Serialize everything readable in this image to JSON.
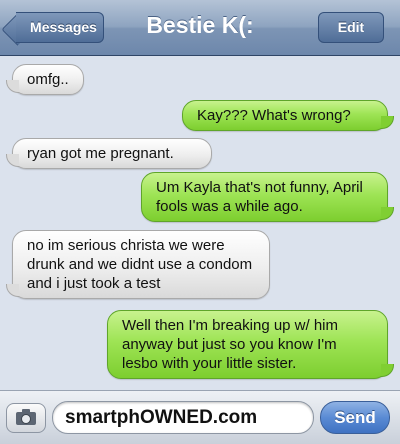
{
  "header": {
    "title": "Bestie K(:",
    "back_label": "Messages",
    "edit_label": "Edit"
  },
  "messages": [
    {
      "direction": "received",
      "text": "omfg.."
    },
    {
      "direction": "sent",
      "text": "Kay??? What's wrong?"
    },
    {
      "direction": "received",
      "text": "ryan got me pregnant."
    },
    {
      "direction": "sent",
      "text": "Um Kayla that's not funny, April fools was a while ago."
    },
    {
      "direction": "received",
      "text": "no im serious christa we were drunk and we didnt use a condom and i just took a test"
    },
    {
      "direction": "sent",
      "text": "Well then I'm breaking up w/ him anyway but just so you know I'm lesbo with your little sister."
    }
  ],
  "composer": {
    "camera_icon": "camera-icon",
    "input_value": "smartphOWNED.com",
    "send_label": "Send"
  },
  "colors": {
    "received_bubble": "#eeeeee",
    "sent_bubble": "#9ee455",
    "navbar": "#7d95b5",
    "background": "#dbe2ed",
    "send_button": "#5a8bd4"
  }
}
